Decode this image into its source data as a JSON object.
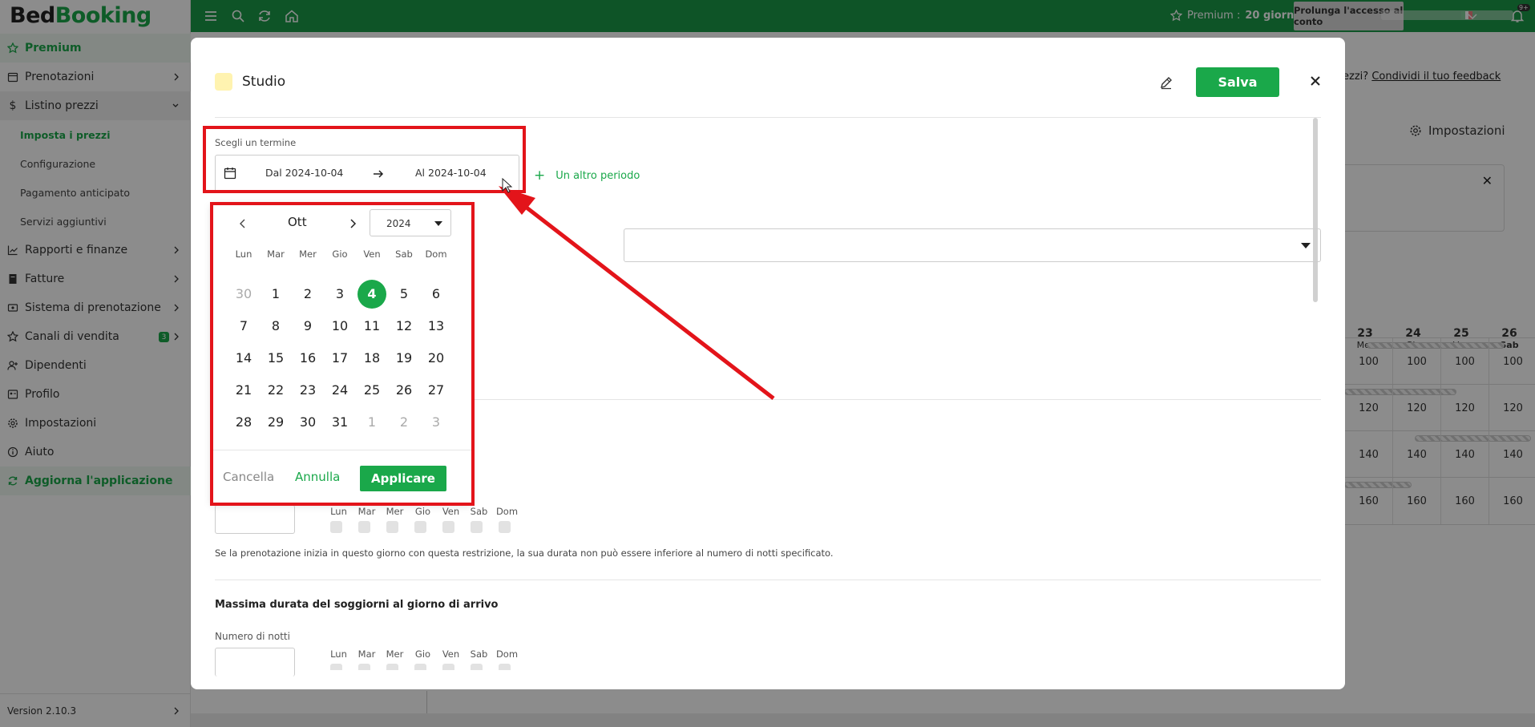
{
  "app": {
    "logo_part1": "Bed",
    "logo_part2": "Booking",
    "brand_color": "#1aa84a"
  },
  "sidebar": {
    "premium": "Premium",
    "items": [
      {
        "label": "Prenotazioni",
        "icon": "calendar-icon"
      },
      {
        "label": "Listino prezzi",
        "icon": "dollar-icon"
      },
      {
        "label": "Rapporti e finanze",
        "icon": "chart-icon"
      },
      {
        "label": "Fatture",
        "icon": "invoice-icon"
      },
      {
        "label": "Sistema di prenotazione",
        "icon": "booking-system-icon"
      },
      {
        "label": "Canali di vendita",
        "icon": "star-icon",
        "badge": "3"
      },
      {
        "label": "Dipendenti",
        "icon": "user-add-icon"
      },
      {
        "label": "Profilo",
        "icon": "profile-icon"
      },
      {
        "label": "Impostazioni",
        "icon": "gear-icon"
      },
      {
        "label": "Aiuto",
        "icon": "info-icon"
      }
    ],
    "sub_items": [
      "Imposta i prezzi",
      "Configurazione",
      "Pagamento anticipato",
      "Servizi aggiuntivi"
    ],
    "update": "Aggiorna l'applicazione",
    "version": "Version 2.10.3"
  },
  "topbar": {
    "premium_label": "Premium :",
    "premium_days": "20 giorni",
    "prolong": "Prolunga l'accesso al conto",
    "notif_badge": "9+"
  },
  "background": {
    "feedback_prefix": "ezzi?",
    "feedback_link": "Condividi il tuo feedback",
    "settings": "Impostazioni",
    "calendar_days": [
      {
        "num": "23",
        "dow": "Mer"
      },
      {
        "num": "24",
        "dow": "Gio"
      },
      {
        "num": "25",
        "dow": "Ven"
      },
      {
        "num": "26",
        "dow": "Sab"
      }
    ],
    "price_rows": [
      [
        "100",
        "100",
        "100",
        "100"
      ],
      [
        "120",
        "120",
        "120",
        "120"
      ],
      [
        "140",
        "140",
        "140",
        "140"
      ],
      [
        "160",
        "160",
        "160",
        "160"
      ]
    ]
  },
  "modal": {
    "title": "Studio",
    "save": "Salva",
    "term_label": "Scegli un termine",
    "from": "Dal 2024-10-04",
    "to": "Al 2024-10-04",
    "another_period": "Un altro periodo",
    "help_text": "Se la prenotazione inizia in questo giorno con questa restrizione, la sua durata non può essere inferiore al numero di notti specificato.",
    "max_title": "Massima durata del soggiorni al giorno di arrivo",
    "nights_label": "Numero di notti",
    "days_short": [
      "Lun",
      "Mar",
      "Mer",
      "Gio",
      "Ven",
      "Sab",
      "Dom"
    ]
  },
  "datepicker": {
    "month": "Ott",
    "year": "2024",
    "dow": [
      "Lun",
      "Mar",
      "Mer",
      "Gio",
      "Ven",
      "Sab",
      "Dom"
    ],
    "weeks": [
      [
        "30",
        "1",
        "2",
        "3",
        "4",
        "5",
        "6"
      ],
      [
        "7",
        "8",
        "9",
        "10",
        "11",
        "12",
        "13"
      ],
      [
        "14",
        "15",
        "16",
        "17",
        "18",
        "19",
        "20"
      ],
      [
        "21",
        "22",
        "23",
        "24",
        "25",
        "26",
        "27"
      ],
      [
        "28",
        "29",
        "30",
        "31",
        "1",
        "2",
        "3"
      ]
    ],
    "selected_day": "4",
    "cancel": "Cancella",
    "undo": "Annulla",
    "apply": "Applicare"
  }
}
